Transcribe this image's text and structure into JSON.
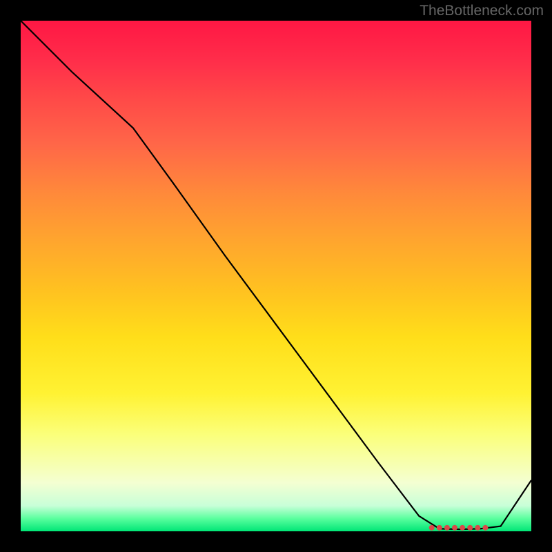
{
  "watermark": "TheBottleneck.com",
  "chart_data": {
    "type": "line",
    "title": "",
    "xlabel": "",
    "ylabel": "",
    "xlim": [
      0,
      100
    ],
    "ylim": [
      0,
      100
    ],
    "grid": false,
    "series": [
      {
        "name": "curve",
        "x": [
          0,
          10,
          22,
          30,
          40,
          50,
          60,
          70,
          78,
          82,
          86,
          90,
          94,
          100
        ],
        "values": [
          100,
          90,
          79,
          68,
          54,
          40.5,
          27,
          13.5,
          3,
          0.5,
          0.4,
          0.5,
          1,
          10
        ]
      }
    ],
    "markers": {
      "name": "flat-region",
      "x": [
        80.5,
        82,
        83.5,
        85,
        86.5,
        88,
        89.5,
        91
      ],
      "values": [
        0.7,
        0.7,
        0.7,
        0.7,
        0.7,
        0.7,
        0.7,
        0.7
      ],
      "color": "#d94a4a",
      "radius": 4
    },
    "line_color": "#000000",
    "line_width": 2.2
  }
}
